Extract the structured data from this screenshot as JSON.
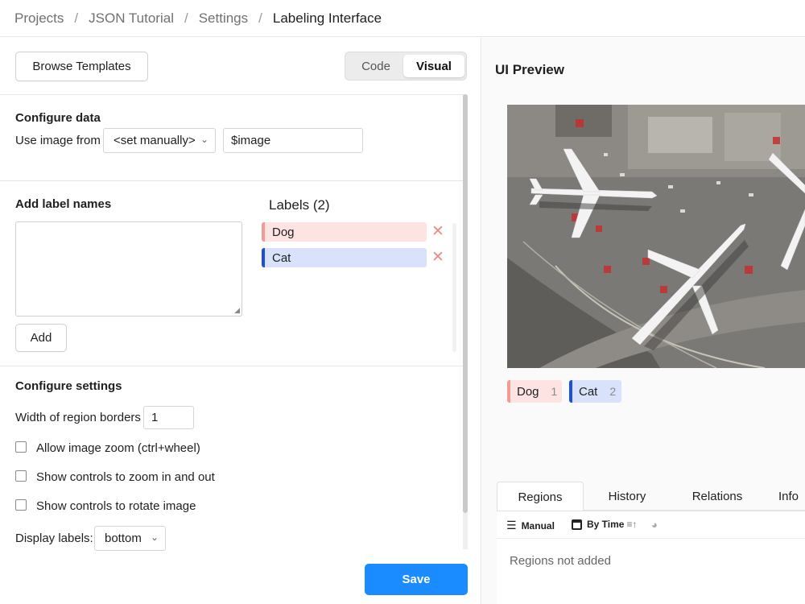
{
  "breadcrumb": [
    "Projects",
    "JSON Tutorial",
    "Settings",
    "Labeling Interface"
  ],
  "left": {
    "browse_templates": "Browse Templates",
    "mode_toggle": {
      "code": "Code",
      "visual": "Visual",
      "selected": "Visual"
    },
    "configure_data": {
      "title": "Configure data",
      "use_image_from_label": "Use image from",
      "source_select": "<set manually>",
      "value_input": "$image"
    },
    "add_label_names": {
      "title": "Add label names",
      "textarea_value": "",
      "add_button": "Add"
    },
    "labels": {
      "title": "Labels (2)",
      "items": [
        {
          "name": "Dog",
          "color": "#f29b94",
          "bg": "#fde4e2"
        },
        {
          "name": "Cat",
          "color": "#1d4fd8",
          "bg": "#d9e2fb"
        }
      ]
    },
    "configure_settings": {
      "title": "Configure settings",
      "width_label": "Width of region borders",
      "width_value": "1",
      "checkboxes": [
        {
          "label": "Allow image zoom (ctrl+wheel)",
          "checked": false
        },
        {
          "label": "Show controls to zoom in and out",
          "checked": false
        },
        {
          "label": "Show controls to rotate image",
          "checked": false
        }
      ],
      "display_labels_label": "Display labels:",
      "display_labels_value": "bottom"
    },
    "save": "Save"
  },
  "right": {
    "title": "UI Preview",
    "labels": [
      {
        "name": "Dog",
        "hotkey": "1",
        "color": "#f29b94",
        "bg": "#fde4e2"
      },
      {
        "name": "Cat",
        "hotkey": "2",
        "color": "#1d4fd8",
        "bg": "#d9e2fb"
      }
    ],
    "tabs": [
      "Regions",
      "History",
      "Relations",
      "Info"
    ],
    "active_tab": "Regions",
    "toolbar": {
      "manual": "Manual",
      "by_time": "By Time"
    },
    "empty_text": "Regions not added"
  },
  "colors": {
    "accent": "#1a8cff",
    "danger": "#f08a8a"
  }
}
